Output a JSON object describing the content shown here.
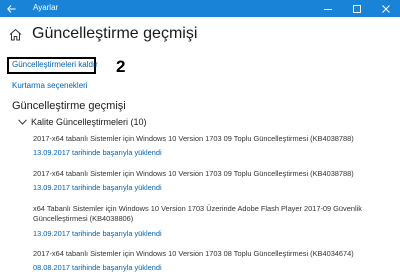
{
  "window": {
    "title": "Ayarlar",
    "controls": [
      "minimize-icon",
      "maximize-icon",
      "close-icon"
    ],
    "titlebar_color": "#1883d7"
  },
  "header": {
    "home_icon": "home-icon",
    "title": "Güncelleştirme geçmişi"
  },
  "links": {
    "uninstall": "Güncelleştirmeleri kaldır",
    "recovery": "Kurtarma seçenekleri"
  },
  "annotation": {
    "step": "2"
  },
  "history": {
    "section_title": "Güncelleştirme geçmişi",
    "group_label": "Kalite Güncelleştirmeleri (10)",
    "items": [
      {
        "title": "2017-x64 tabanlı Sistemler için Windows 10 Version 1703 09 Toplu Güncelleştirmesi (KB4038788)",
        "status": "13.09.2017 tarihinde başarıyla yüklendi"
      },
      {
        "title": "2017-x64 tabanlı Sistemler için Windows 10 Version 1703 09 Toplu Güncelleştirmesi (KB4038788)",
        "status": "13.09.2017 tarihinde başarıyla yüklendi"
      },
      {
        "title": "x64 Tabanlı Sistemler için Windows 10 Version 1703 Üzerinde Adobe Flash Player 2017-09 Güvenlik Güncelleştirmesi (KB4038806)",
        "status": "13.09.2017 tarihinde başarıyla yüklendi"
      },
      {
        "title": "2017-x64 tabanlı Sistemler için Windows 10 Version 1703 08 Toplu Güncelleştirmesi (KB4034674)",
        "status": "08.08.2017 tarihinde başarıyla yüklendi"
      }
    ]
  },
  "colors": {
    "link": "#0063b1",
    "accent": "#1883d7"
  }
}
